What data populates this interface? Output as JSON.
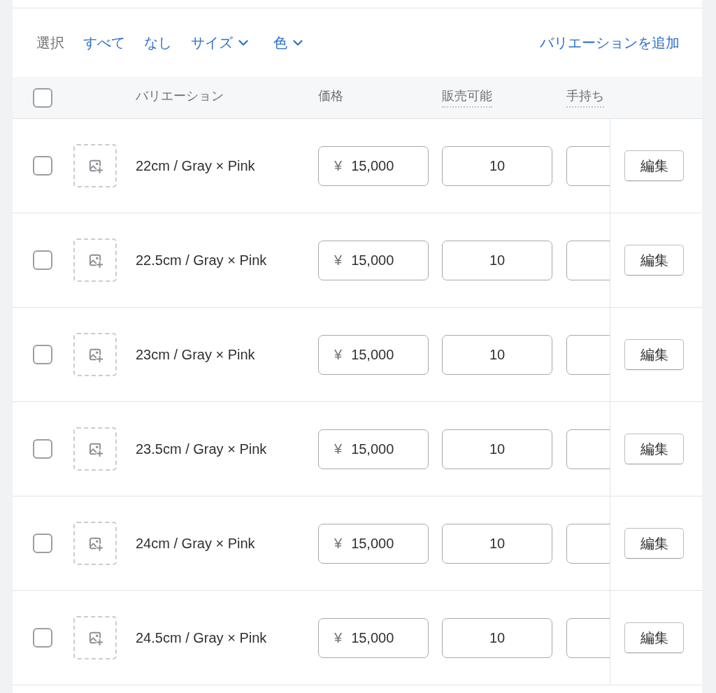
{
  "toolbar": {
    "select_label": "選択",
    "options": [
      {
        "kind": "link",
        "label": "すべて"
      },
      {
        "kind": "link",
        "label": "なし"
      },
      {
        "kind": "dropdown",
        "label": "サイズ"
      },
      {
        "kind": "dropdown",
        "label": "色"
      }
    ],
    "add_variant": "バリエーションを追加"
  },
  "table": {
    "select_all": {
      "checked": false
    },
    "columns": [
      {
        "label": "バリエーション",
        "dotted_underline": false
      },
      {
        "label": "価格",
        "dotted_underline": false
      },
      {
        "label": "販売可能",
        "dotted_underline": true
      },
      {
        "label": "手持ち",
        "dotted_underline": true
      }
    ],
    "rows": [
      {
        "checked": false,
        "variant": "22cm / Gray × Pink",
        "currency": "¥",
        "price": "15,000",
        "available": "10",
        "edit_label": "編集"
      },
      {
        "checked": false,
        "variant": "22.5cm / Gray × Pink",
        "currency": "¥",
        "price": "15,000",
        "available": "10",
        "edit_label": "編集"
      },
      {
        "checked": false,
        "variant": "23cm / Gray × Pink",
        "currency": "¥",
        "price": "15,000",
        "available": "10",
        "edit_label": "編集"
      },
      {
        "checked": false,
        "variant": "23.5cm / Gray × Pink",
        "currency": "¥",
        "price": "15,000",
        "available": "10",
        "edit_label": "編集"
      },
      {
        "checked": false,
        "variant": "24cm / Gray × Pink",
        "currency": "¥",
        "price": "15,000",
        "available": "10",
        "edit_label": "編集"
      },
      {
        "checked": false,
        "variant": "24.5cm / Gray × Pink",
        "currency": "¥",
        "price": "15,000",
        "available": "10",
        "edit_label": "編集"
      }
    ]
  }
}
